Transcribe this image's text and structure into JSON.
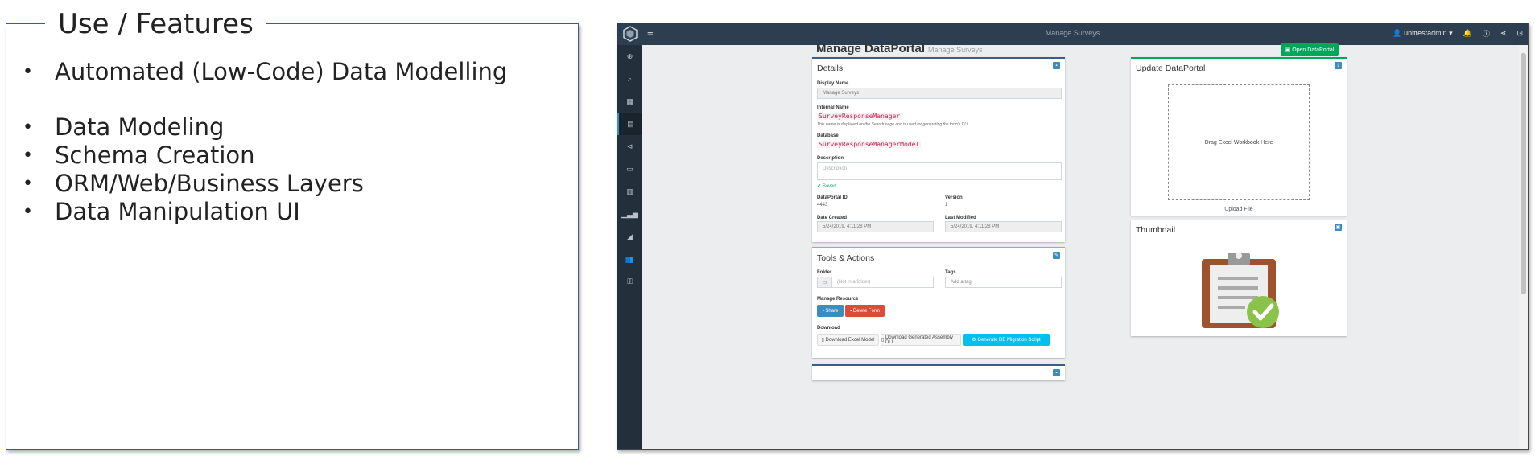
{
  "features": {
    "title": "Use / Features",
    "items": [
      "Automated (Low-Code) Data Modelling",
      "Data Modeling",
      "Schema Creation",
      "ORM/Web/Business Layers",
      "Data Manipulation UI"
    ]
  },
  "app": {
    "topbar_title": "Manage Surveys",
    "user": "unittestadmin",
    "page_title": "Manage DataPortal",
    "page_subtitle": "Manage Surveys",
    "open_button": "Open DataPortal",
    "details": {
      "title": "Details",
      "display_name_label": "Display Name",
      "display_name_value": "Manage Surveys",
      "internal_name_label": "Internal Name",
      "internal_name_value": "SurveyResponseManager",
      "internal_name_note": "This name is displayed on the Search page and is used for generating the form's DLL.",
      "database_label": "Database",
      "database_value": "SurveyResponseManagerModel",
      "description_label": "Description",
      "description_placeholder": "Description",
      "saved_text": "Saved",
      "dataportal_id_label": "DataPortal ID",
      "dataportal_id_value": "4443",
      "version_label": "Version",
      "version_value": "1",
      "date_created_label": "Date Created",
      "date_created_value": "5/24/2019, 4:11:28 PM",
      "last_modified_label": "Last Modified",
      "last_modified_value": "5/24/2019, 4:11:28 PM"
    },
    "tools": {
      "title": "Tools & Actions",
      "folder_label": "Folder",
      "folder_placeholder": "(Not in a folder)",
      "tags_label": "Tags",
      "tags_placeholder": "Add a tag",
      "manage_label": "Manage Resource",
      "share_button": "Share",
      "delete_button": "Delete Form",
      "download_label": "Download",
      "download_excel": "Download Excel Model",
      "download_dll": "Download Generated Assembly DLL",
      "generate_script": "Generate DB Migration Script"
    },
    "update": {
      "title": "Update DataPortal",
      "drop_text": "Drag Excel Workbook Here",
      "upload_label": "Upload File"
    },
    "thumbnail": {
      "title": "Thumbnail"
    },
    "colors": {
      "topbar": "#2c3e50",
      "accent_blue": "#3c8dbc",
      "success_green": "#00a65a",
      "danger_red": "#dd4b39",
      "info_cyan": "#00c0ef"
    }
  }
}
